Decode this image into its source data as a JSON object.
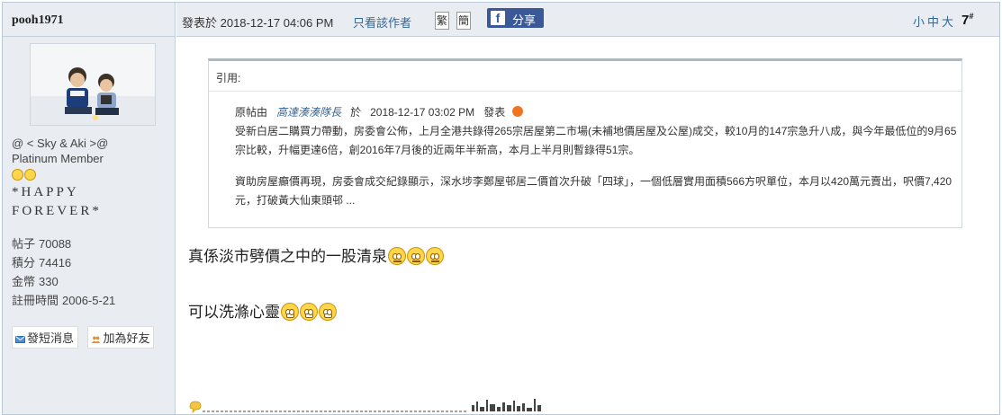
{
  "user": {
    "username": "pooh1971",
    "nickname": "@ < Sky & Aki >@",
    "group": "Platinum Member",
    "signature": "*HAPPY FOREVER*",
    "stats": [
      {
        "label": "帖子",
        "value": "70088"
      },
      {
        "label": "積分",
        "value": "74416"
      },
      {
        "label": "金幣",
        "value": "330"
      },
      {
        "label": "註冊時間",
        "value": "2006-5-21"
      }
    ],
    "actions": {
      "message": "發短消息",
      "add_friend": "加為好友"
    }
  },
  "header": {
    "posted_at": "發表於 2018-12-17 04:06 PM",
    "author_only": "只看該作者",
    "trad_btn": "繁",
    "simp_btn": "簡",
    "share": "分享",
    "font_sizes": "小中大",
    "floor": "7",
    "floor_mark": "#"
  },
  "quote": {
    "heading": "引用:",
    "prefix": "原帖由",
    "author": "高達湊湊隊長",
    "at": "於",
    "time": "2018-12-17  03:02  PM",
    "suffix": "發表",
    "para1": "受新白居二購買力帶動，房委會公佈，上月全港共錄得265宗居屋第二市場(未補地價居屋及公屋)成交，較10月的147宗急升八成，與今年最低位的9月65宗比較，升幅更達6倍，創2016年7月後的近兩年半新高，本月上半月則暫錄得51宗。",
    "para2": "資助房屋癲價再現，房委會成交紀錄顯示，深水埗李鄭屋邨居二價首次升破「四球」，一個低層實用面積566方呎單位，本月以420萬元賣出，呎價7,420元，打破黃大仙東頭邨 ..."
  },
  "message": {
    "line1": "真係淡市劈價之中的一股清泉",
    "line2": "可以洗滌心靈"
  },
  "colors": {
    "accent": "#336699",
    "header_bg": "#e9edf2",
    "facebook": "#3b5998"
  }
}
